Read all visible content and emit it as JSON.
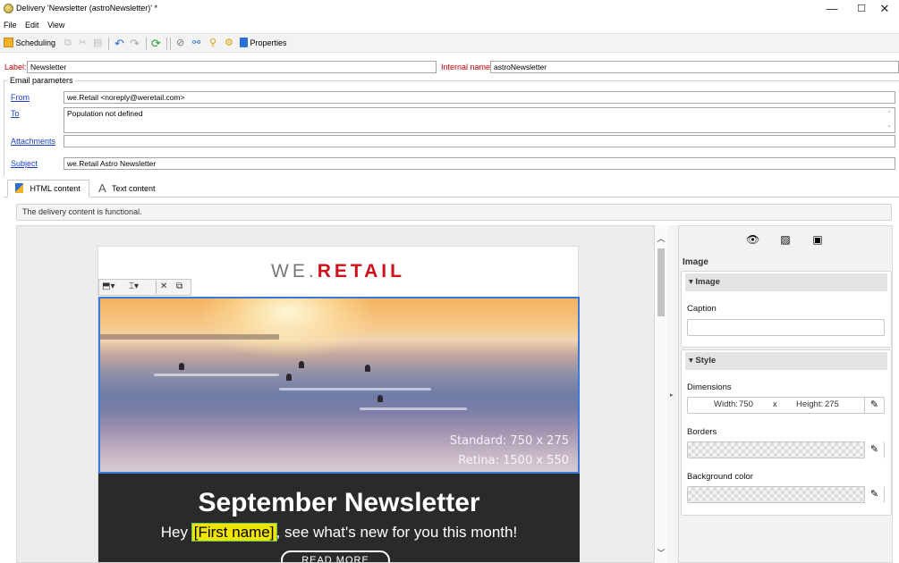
{
  "window": {
    "title": "Delivery 'Newsletter (astroNewsletter)' *",
    "controls": {
      "minimize": "—",
      "maximize": "☐",
      "close": "✕"
    }
  },
  "menu": [
    "File",
    "Edit",
    "View"
  ],
  "toolbar": {
    "scheduling": "Scheduling",
    "properties": "Properties"
  },
  "delivery": {
    "label_caption": "Label:",
    "label_value": "Newsletter",
    "internal_caption": "Internal name:",
    "internal_value": "astroNewsletter"
  },
  "email_params": {
    "title": "Email parameters",
    "from_label": "From",
    "from_value": "we.Retail <noreply@weretail.com>",
    "to_label": "To",
    "to_value": "Population not defined",
    "attachments_label": "Attachments",
    "attachments_value": "",
    "subject_label": "Subject",
    "subject_value": "we.Retail Astro Newsletter"
  },
  "tabs": [
    "HTML content",
    "Text content"
  ],
  "status": "The delivery content is functional.",
  "email": {
    "logo_left": "WE.",
    "logo_right": "RETAIL",
    "image_standard": "Standard: 750 x 275",
    "image_retina": "Retina: 1500 x 550",
    "headline": "September Newsletter",
    "greeting_before": "Hey ",
    "greeting_personalization": "[First name]",
    "greeting_after": ", see what's new for you this month!",
    "button": "READ MORE"
  },
  "panel": {
    "title": "Image",
    "image_section": "Image",
    "caption_label": "Caption",
    "caption_value": "",
    "style_section": "Style",
    "dimensions_label": "Dimensions",
    "width_label": "Width:",
    "width_value": "750",
    "x_sep": "x",
    "height_label": "Height:",
    "height_value": "275",
    "borders_label": "Borders",
    "background_label": "Background color"
  }
}
